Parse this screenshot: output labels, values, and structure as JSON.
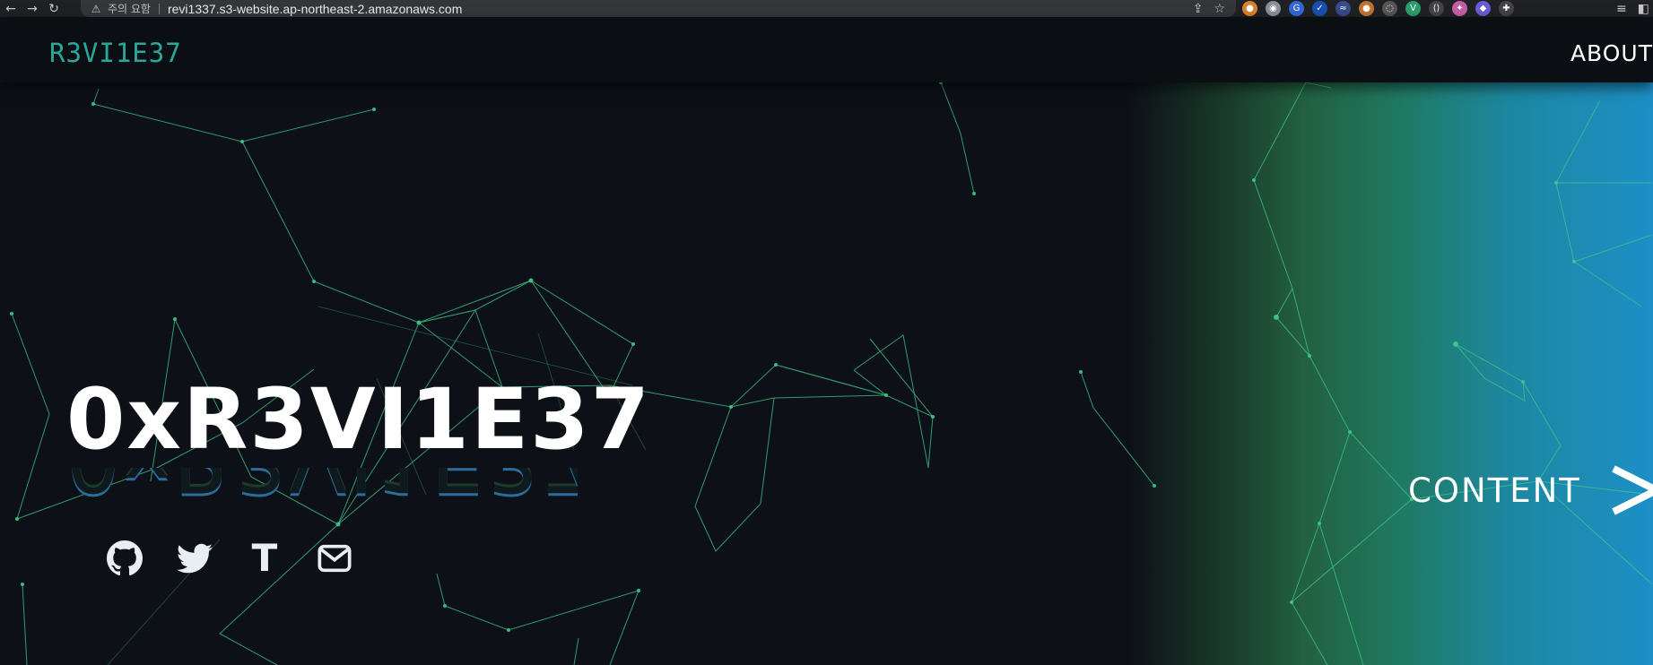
{
  "browser": {
    "security_label": "주의 요함",
    "url": "revi1337.s3-website.ap-northeast-2.amazonaws.com",
    "extensions": [
      {
        "icon": "cookie-icon",
        "color": "#d9822b",
        "glyph": "●"
      },
      {
        "icon": "ninja-icon",
        "color": "#8a8f98",
        "glyph": "◉"
      },
      {
        "icon": "translate-icon",
        "color": "#3367d6",
        "glyph": "G"
      },
      {
        "icon": "check-icon",
        "color": "#1a4fb0",
        "glyph": "✓"
      },
      {
        "icon": "wave-icon",
        "color": "#3a4a8a",
        "glyph": "≈"
      },
      {
        "icon": "cookie2-icon",
        "color": "#c0742e",
        "glyph": "●"
      },
      {
        "icon": "reload-circle-icon",
        "color": "#555",
        "glyph": "◌"
      },
      {
        "icon": "vue-icon",
        "color": "#2a9d6a",
        "glyph": "V"
      },
      {
        "icon": "bracket-icon",
        "color": "#444",
        "glyph": "⟨⟩"
      },
      {
        "icon": "rainbow-icon",
        "color": "#c45da8",
        "glyph": "✦"
      },
      {
        "icon": "mask-icon",
        "color": "#6b5bd6",
        "glyph": "◆"
      },
      {
        "icon": "puzzle-icon",
        "color": "#444",
        "glyph": "✚"
      }
    ]
  },
  "site": {
    "logo": "R3VI1E37",
    "nav_about": "ABOUT",
    "hero_title": "0xR3VI1E37",
    "content_label": "CONTENT",
    "social": [
      {
        "name": "github-icon"
      },
      {
        "name": "twitter-icon"
      },
      {
        "name": "tistory-icon",
        "glyph": "T"
      },
      {
        "name": "mail-icon"
      }
    ]
  },
  "colors": {
    "background": "#0d1117",
    "accent": "#2aa79b",
    "network_line": "#3ec98a",
    "gradient_end": "#1d8fc7"
  }
}
